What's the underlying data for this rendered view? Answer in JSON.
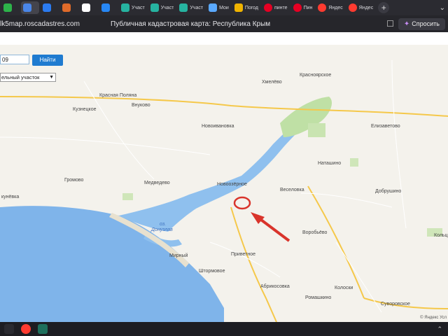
{
  "tabs": [
    {
      "label": "",
      "favicon": "green-app-icon",
      "color": "#2db34a"
    },
    {
      "label": "",
      "favicon": "window-icon",
      "color": "#4a86e8",
      "active": true
    },
    {
      "label": "",
      "favicon": "mail-icon",
      "color": "#2b7bf0"
    },
    {
      "label": "",
      "favicon": "tool-icon",
      "color": "#e06b2a"
    },
    {
      "label": "",
      "favicon": "bookmark-icon",
      "color": "#ffffff"
    },
    {
      "label": "",
      "favicon": "vk-icon",
      "color": "#2787f5"
    },
    {
      "label": "Участ",
      "favicon": "leaf-icon",
      "color": "#26b3a0"
    },
    {
      "label": "Участ",
      "favicon": "leaf-icon",
      "color": "#26b3a0"
    },
    {
      "label": "Участ",
      "favicon": "leaf-icon",
      "color": "#26b3a0"
    },
    {
      "label": "Мои",
      "favicon": "y-icon",
      "color": "#5aa9ff"
    },
    {
      "label": "Погод",
      "favicon": "weather-icon",
      "color": "#f0b400"
    },
    {
      "label": "пинте",
      "favicon": "pinterest-icon",
      "color": "#e60023"
    },
    {
      "label": "Пин",
      "favicon": "pinterest-icon",
      "color": "#e60023"
    },
    {
      "label": "Яндес",
      "favicon": "map-pin-icon",
      "color": "#ff3b30"
    },
    {
      "label": "Яндес",
      "favicon": "map-pin-icon",
      "color": "#ff3b30"
    }
  ],
  "address": {
    "url": "lk5map.roscadastres.com",
    "title": "Публичная кадастровая карта: Республика Крым",
    "ask_label": "Спросить"
  },
  "map_controls": {
    "cadastral_number": "09",
    "find_label": "Найти",
    "type_select": "ельный участок"
  },
  "map_labels": [
    "Красноярское",
    "Хмелёво",
    "Красная Поляна",
    "Внуково",
    "Кузнецкое",
    "Новоивановка",
    "Елизаветово",
    "Наташино",
    "Громово",
    "Медведево",
    "Новоозёрное",
    "Веселовка",
    "Добрушино",
    "кунёвка",
    "оз.",
    "Донузлав",
    "Воробьёво",
    "Кольц",
    "Мирный",
    "Приветное",
    "Штормовое",
    "Абрикосовка",
    "Колоски",
    "Ромашкино",
    "Суворовское"
  ],
  "attribution": "© Яндекс  Усл",
  "colors": {
    "water": "#7fb4ea",
    "field": "#f4f2ec",
    "road": "#f5c84a",
    "highlight": "#d9342b",
    "button": "#1f7bd0"
  }
}
